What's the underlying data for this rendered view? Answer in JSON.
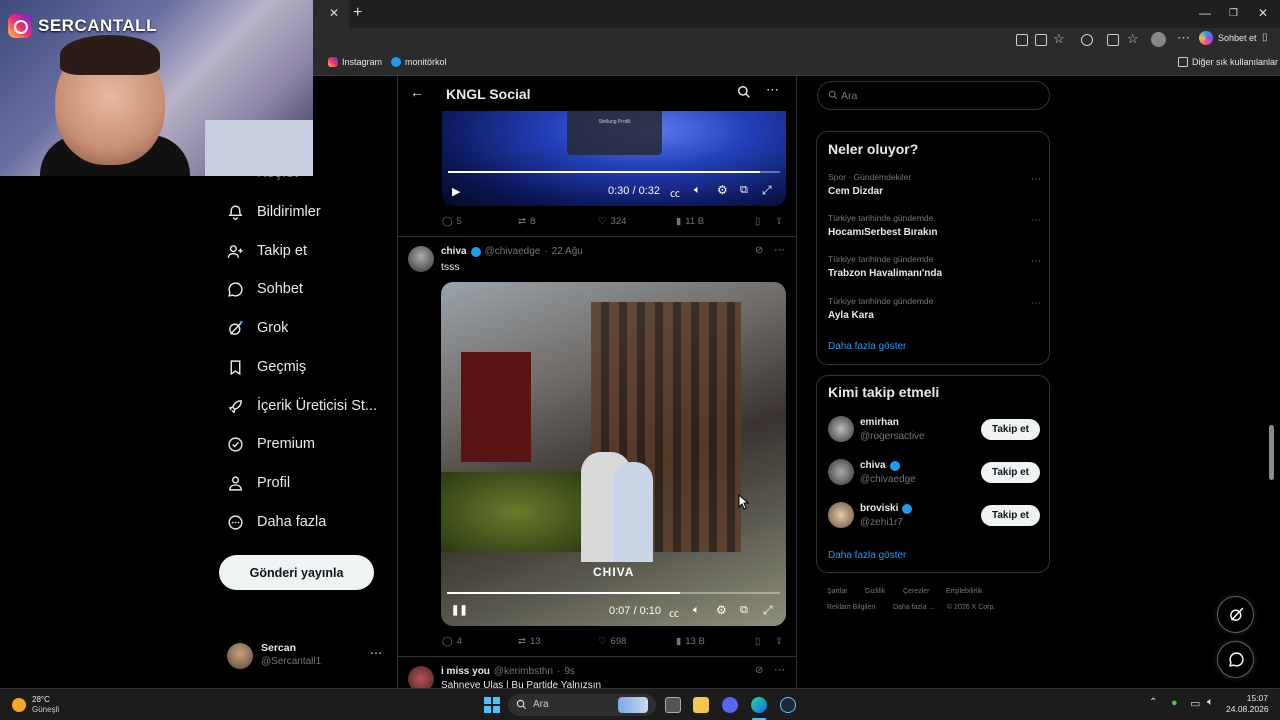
{
  "overlay": {
    "streamer_name": "SERCANTALL"
  },
  "browser": {
    "bookmarks": [
      {
        "label": "Instagram",
        "icon": "instagram-icon"
      },
      {
        "label": "monitörkol",
        "icon": "check-badge-icon"
      }
    ],
    "other_bookmarks": "Diğer sık kullanılanlar",
    "chat_label": "Sohbet et"
  },
  "nav": {
    "partial_item": "Keşfet",
    "items": [
      {
        "label": "Bildirimler",
        "icon": "bell-icon"
      },
      {
        "label": "Takip et",
        "icon": "follow-icon"
      },
      {
        "label": "Sohbet",
        "icon": "chat-icon"
      },
      {
        "label": "Grok",
        "icon": "grok-icon"
      },
      {
        "label": "Geçmiş",
        "icon": "bookmark-icon"
      },
      {
        "label": "İçerik Üreticisi St...",
        "icon": "rocket-icon"
      },
      {
        "label": "Premium",
        "icon": "verified-icon"
      },
      {
        "label": "Profil",
        "icon": "person-icon"
      },
      {
        "label": "Daha fazla",
        "icon": "more-circle-icon"
      }
    ],
    "post_button": "Gönderi yayınla",
    "account": {
      "name": "Sercan",
      "handle": "@Sercantall1"
    }
  },
  "header": {
    "title": "KNGL Social"
  },
  "feed": {
    "first_video": {
      "time": "0:30 / 0:32",
      "progress": 0.94,
      "overlay_title": "Stellung Profili"
    },
    "first_actions": {
      "replies": "5",
      "reposts": "8",
      "likes": "324",
      "views": "11 B"
    },
    "post": {
      "name": "chiva",
      "handle": "@chivaedge",
      "date": "22 Ağu",
      "text": "tsss",
      "video_watermark": "CHIVA",
      "video_time": "0:07 / 0:10",
      "progress": 0.7,
      "actions": {
        "replies": "4",
        "reposts": "13",
        "likes": "698",
        "views": "13 B"
      }
    },
    "next_post": {
      "name": "i miss you",
      "handle": "@kerimbsthn",
      "date": "9s",
      "text": "Sahneye Ulaş | Bu Partide Yalnızsın"
    }
  },
  "right": {
    "search_placeholder": "Ara",
    "trends_title": "Neler oluyor?",
    "trends": [
      {
        "context": "Spor · Gündemdekiler",
        "name": "Cem Dizdar"
      },
      {
        "context": "Türkiye tarihinde gündemde",
        "name": "HocamıSerbest Bırakın"
      },
      {
        "context": "Türkiye tarihinde gündemde",
        "name": "Trabzon Havalimanı'nda"
      },
      {
        "context": "Türkiye tarihinde gündemde",
        "name": "Ayla Kara"
      }
    ],
    "show_more": "Daha fazla göster",
    "who_title": "Kimi takip etmeli",
    "who": [
      {
        "name": "emirhan",
        "handle": "@rogersactive",
        "verified": false
      },
      {
        "name": "chiva",
        "handle": "@chivaedge",
        "verified": true
      },
      {
        "name": "broviski",
        "handle": "@zehi1r7",
        "verified": true
      }
    ],
    "follow_label": "Takip et",
    "who_more": "Daha fazla göster",
    "footer": [
      "Şartlar",
      "Gizlilik",
      "Çerezler",
      "Erişilebilirlik",
      "Reklam Bilgileri",
      "Daha fazla ...",
      "© 2026 X Corp."
    ]
  },
  "taskbar": {
    "weather_temp": "28°C",
    "weather_desc": "Güneşli",
    "search_label": "Ara",
    "time": "15:07",
    "date": "24.08.2026"
  },
  "colors": {
    "accent": "#1d9bf0",
    "border": "#2f3336",
    "muted": "#71767b"
  }
}
